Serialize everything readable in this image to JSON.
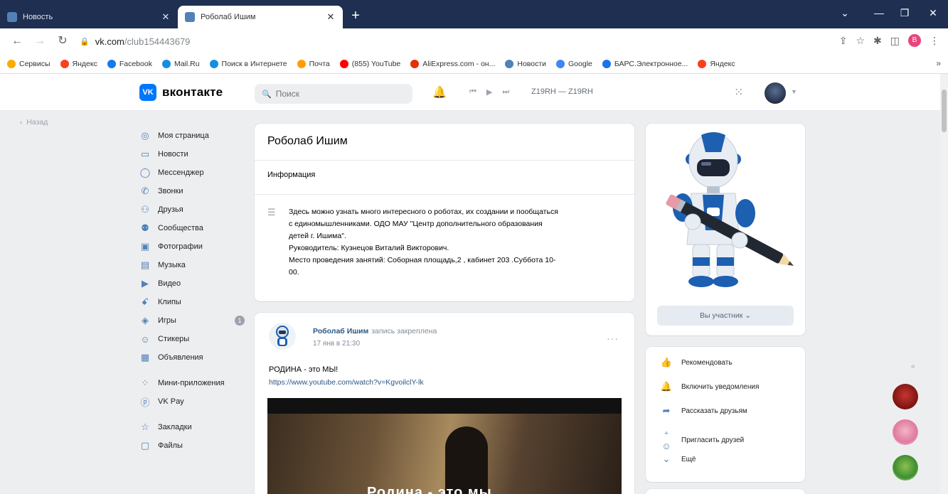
{
  "browser": {
    "tabs": [
      {
        "title": "Новость",
        "active": false
      },
      {
        "title": "Роболаб Ишим",
        "active": true
      }
    ],
    "url_host": "vk.com",
    "url_path": "/club154443679",
    "profile_initial": "В",
    "bookmarks": [
      {
        "label": "Сервисы",
        "color": "#f9ab00"
      },
      {
        "label": "Яндекс",
        "color": "#fc3f1d"
      },
      {
        "label": "Facebook",
        "color": "#1877f2"
      },
      {
        "label": "Mail.Ru",
        "color": "#168de2"
      },
      {
        "label": "Поиск в Интернете",
        "color": "#168de2"
      },
      {
        "label": "Почта",
        "color": "#ff9e00"
      },
      {
        "label": "(855) YouTube",
        "color": "#ff0000"
      },
      {
        "label": "AliExpress.com - он...",
        "color": "#e62e04"
      },
      {
        "label": "Новости",
        "color": "#5181b8"
      },
      {
        "label": "Google",
        "color": "#4285f4"
      },
      {
        "label": "БАРС.Электронное...",
        "color": "#1a73e8"
      },
      {
        "label": "Яндекс",
        "color": "#fc3f1d"
      }
    ]
  },
  "vk": {
    "logo_text": "вконтакте",
    "search_placeholder": "Поиск",
    "track": "Z19RH — Z19RH",
    "back_label": "Назад",
    "nav": [
      {
        "label": "Моя страница",
        "icon": "user-circle-icon",
        "glyph": "◎"
      },
      {
        "label": "Новости",
        "icon": "news-icon",
        "glyph": "▭"
      },
      {
        "label": "Мессенджер",
        "icon": "messenger-icon",
        "glyph": "◯"
      },
      {
        "label": "Звонки",
        "icon": "phone-icon",
        "glyph": "✆"
      },
      {
        "label": "Друзья",
        "icon": "friends-icon",
        "glyph": "⚇"
      },
      {
        "label": "Сообщества",
        "icon": "communities-icon",
        "glyph": "⚉"
      },
      {
        "label": "Фотографии",
        "icon": "photo-icon",
        "glyph": "▣"
      },
      {
        "label": "Музыка",
        "icon": "music-icon",
        "glyph": "▤"
      },
      {
        "label": "Видео",
        "icon": "video-icon",
        "glyph": "▶"
      },
      {
        "label": "Клипы",
        "icon": "clips-icon",
        "glyph": "ꗃ"
      },
      {
        "label": "Игры",
        "icon": "games-icon",
        "glyph": "◈",
        "badge": "1"
      },
      {
        "label": "Стикеры",
        "icon": "stickers-icon",
        "glyph": "☺"
      },
      {
        "label": "Объявления",
        "icon": "ads-icon",
        "glyph": "▦"
      }
    ],
    "nav2": [
      {
        "label": "Мини-приложения",
        "icon": "mini-apps-icon",
        "glyph": "⁘"
      },
      {
        "label": "VK Pay",
        "icon": "vkpay-icon",
        "glyph": "ⓟ"
      }
    ],
    "nav3": [
      {
        "label": "Закладки",
        "icon": "bookmark-star-icon",
        "glyph": "☆"
      },
      {
        "label": "Файлы",
        "icon": "files-icon",
        "glyph": "▢"
      }
    ]
  },
  "group": {
    "name": "Роболаб Ишим",
    "info_heading": "Информация",
    "description_lines": [
      "Здесь можно узнать много интересного о роботах, их создании и пообщаться",
      "с единомышленниками. ОДО МАУ \"Центр дополнительного образования",
      "детей г. Ишима\".",
      "Руководитель: Кузнецов Виталий Викторович.",
      "Место проведения занятий: Соборная площадь,2 , кабинет 203 .Суббота 10-",
      "00."
    ],
    "member_button": "Вы участник",
    "actions": [
      {
        "label": "Рекомендовать",
        "icon": "thumb-up-icon",
        "glyph": "👍"
      },
      {
        "label": "Включить уведомления",
        "icon": "bell-icon",
        "glyph": "🔔"
      },
      {
        "label": "Рассказать друзьям",
        "icon": "share-icon",
        "glyph": "➦"
      },
      {
        "label": "Пригласить друзей",
        "icon": "invite-friends-icon",
        "glyph": "⁺☺"
      },
      {
        "label": "Ещё",
        "icon": "chevron-down-icon",
        "glyph": "⌄"
      }
    ]
  },
  "post": {
    "author": "Роболаб Ишим",
    "note": "запись закреплена",
    "date": "17 янв в 21:30",
    "text": "РОДИНА - это МЫ!",
    "link": "https://www.youtube.com/watch?v=KgvoilclY-lk",
    "video_caption": "Родина - это мы"
  },
  "colors": {
    "vk_blue": "#0077ff",
    "link": "#2a5885",
    "page_bg": "#edeef0",
    "chrome_tabbar": "#1e2f52"
  }
}
